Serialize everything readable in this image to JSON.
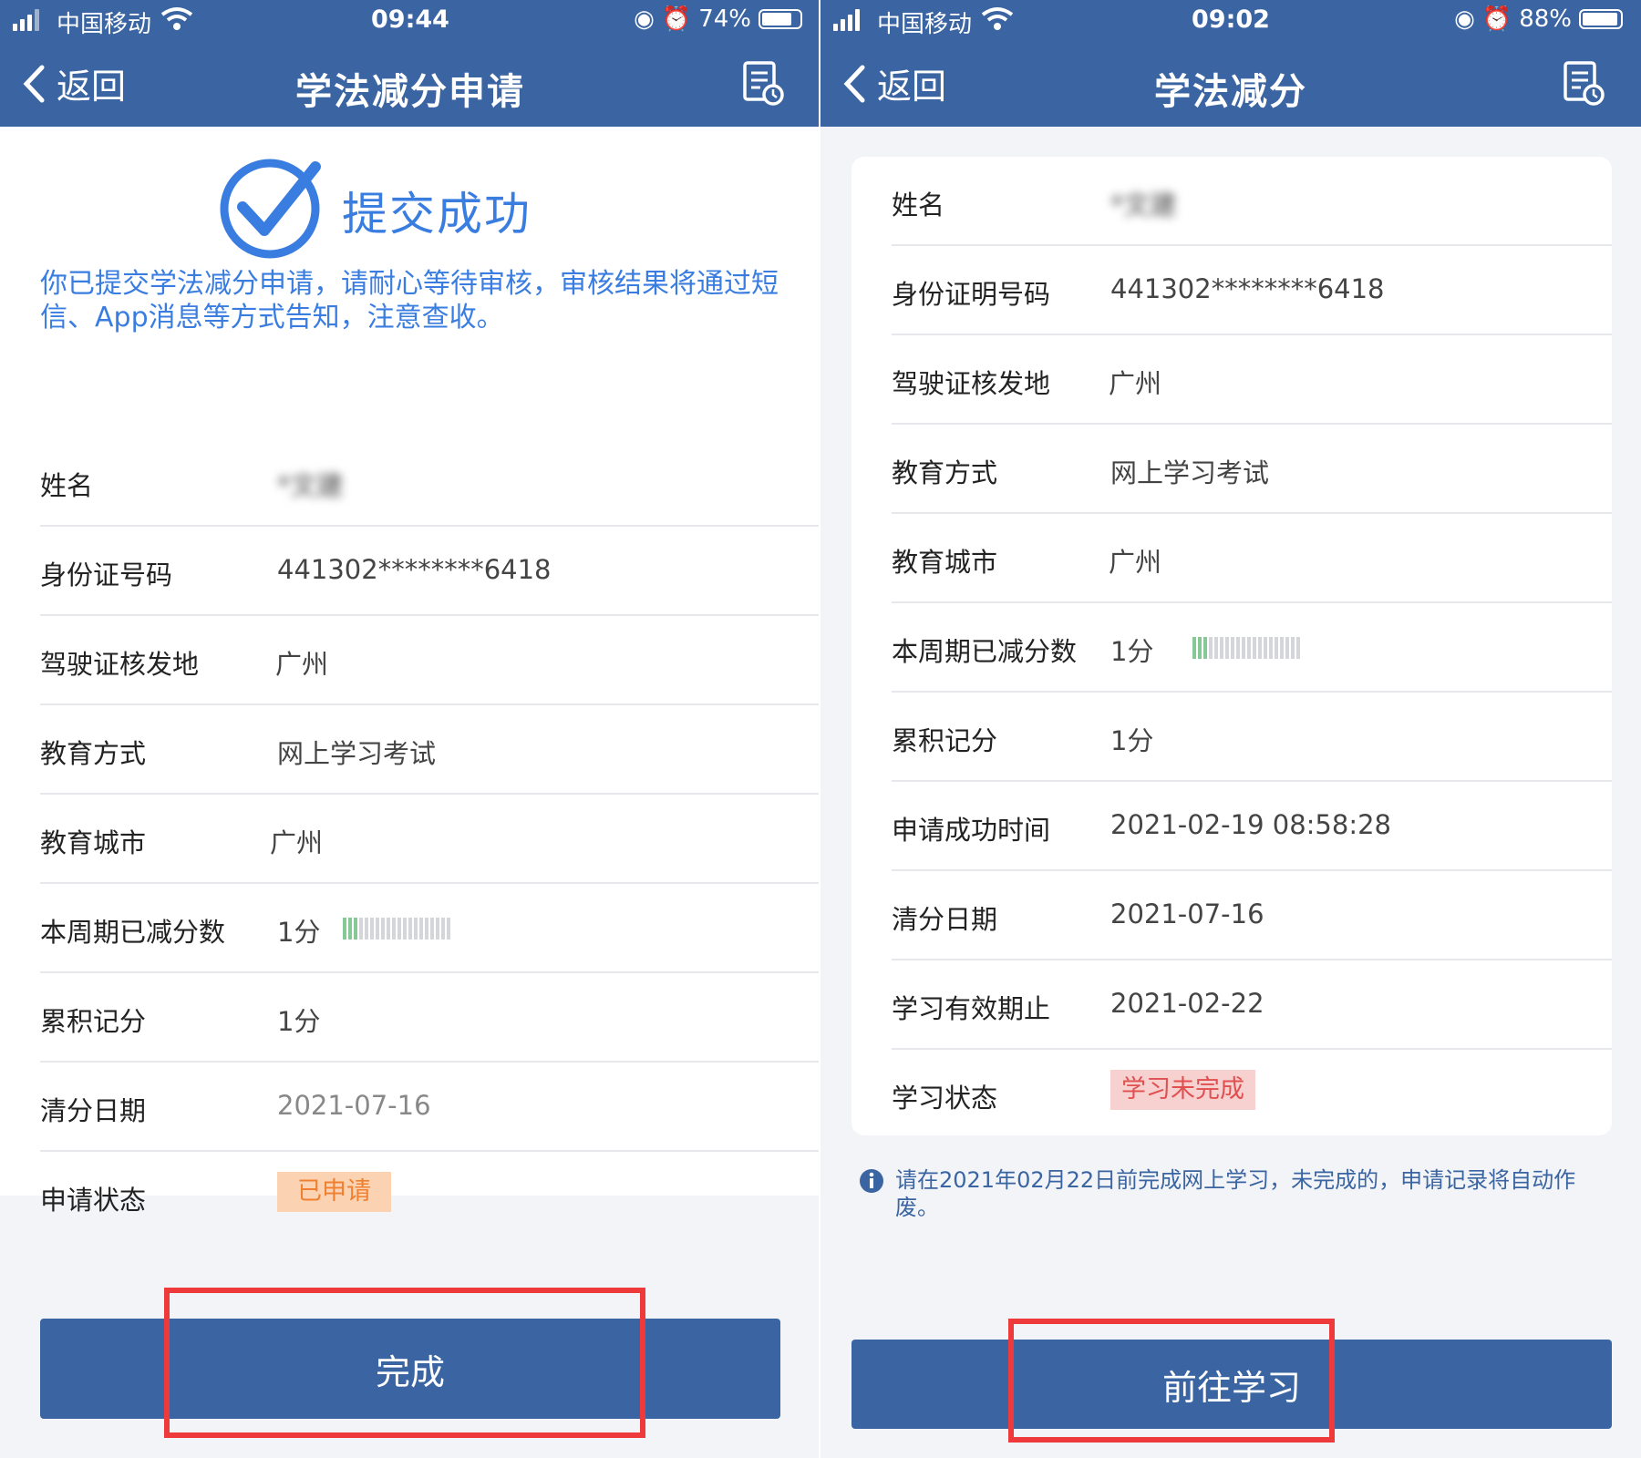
{
  "left": {
    "status": {
      "carrier": "中国移动",
      "time": "09:44",
      "battery": "74%",
      "battery_level": 0.74
    },
    "nav": {
      "back": "返回",
      "title": "学法减分申请",
      "icon": "history-doc-icon"
    },
    "success_title": "提交成功",
    "notice": "你已提交学法减分申请，请耐心等待审核，审核结果将通过短信、App消息等方式告知，注意查收。",
    "rows": [
      {
        "label": "姓名",
        "value": "*文建"
      },
      {
        "label": "身份证号码",
        "value": "441302********6418"
      },
      {
        "label": "驾驶证核发地",
        "value": "广州"
      },
      {
        "label": "教育方式",
        "value": "网上学习考试"
      },
      {
        "label": "教育城市",
        "value": "广州"
      },
      {
        "label": "本周期已减分数",
        "value": "1分"
      },
      {
        "label": "累积记分",
        "value": "1分"
      },
      {
        "label": "清分日期",
        "value": "2021-07-16"
      },
      {
        "label": "申请状态",
        "value": "已申请"
      }
    ],
    "progress_filled": 3,
    "progress_total": 20,
    "button": "完成",
    "colors": {
      "header": "#3a65a2",
      "accent": "#3a7de0",
      "badge_bg": "#fbd3b3",
      "badge_text": "#f08030"
    }
  },
  "right": {
    "status": {
      "carrier": "中国移动",
      "time": "09:02",
      "battery": "88%",
      "battery_level": 0.88
    },
    "nav": {
      "back": "返回",
      "title": "学法减分",
      "icon": "history-doc-icon"
    },
    "rows": [
      {
        "label": "姓名",
        "value": "*文建"
      },
      {
        "label": "身份证明号码",
        "value": "441302********6418"
      },
      {
        "label": "驾驶证核发地",
        "value": "广州"
      },
      {
        "label": "教育方式",
        "value": "网上学习考试"
      },
      {
        "label": "教育城市",
        "value": "广州"
      },
      {
        "label": "本周期已减分数",
        "value": "1分"
      },
      {
        "label": "累积记分",
        "value": "1分"
      },
      {
        "label": "申请成功时间",
        "value": "2021-02-19 08:58:28"
      },
      {
        "label": "清分日期",
        "value": "2021-07-16"
      },
      {
        "label": "学习有效期止",
        "value": "2021-02-22"
      },
      {
        "label": "学习状态",
        "value": "学习未完成"
      }
    ],
    "progress_filled": 3,
    "progress_total": 20,
    "info": "请在2021年02月22日前完成网上学习，未完成的，申请记录将自动作废。",
    "button": "前往学习",
    "colors": {
      "badge_bg": "#f7d0d0",
      "badge_text": "#e05050",
      "highlight": "#ee3a3a"
    }
  }
}
